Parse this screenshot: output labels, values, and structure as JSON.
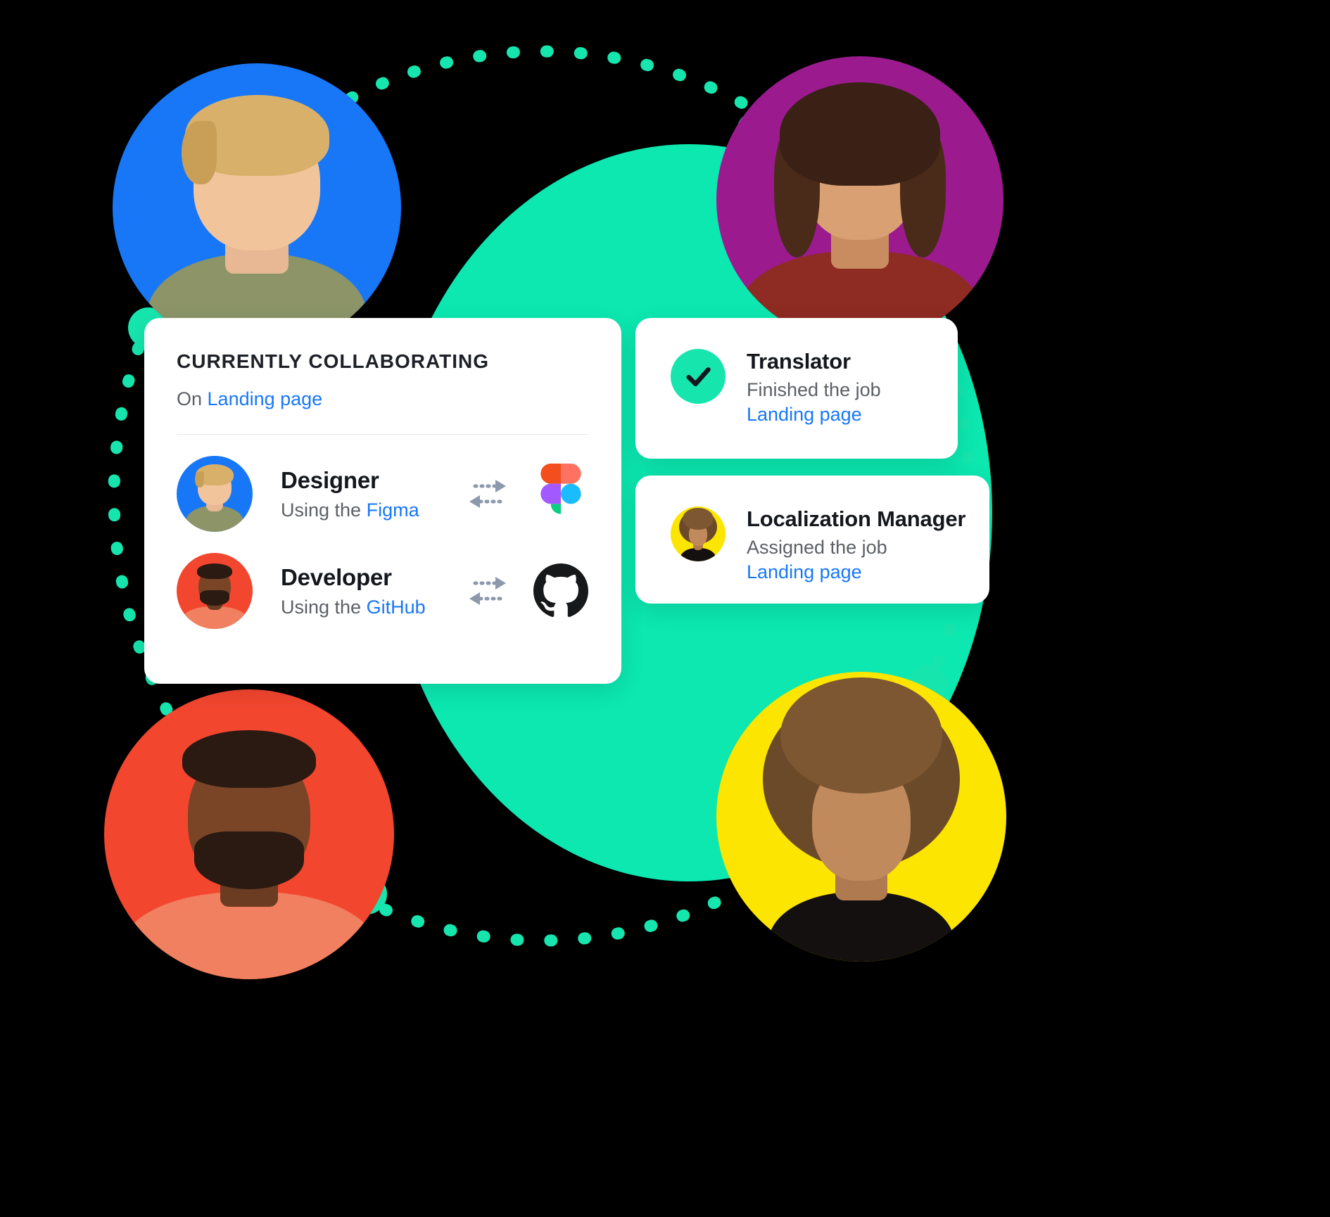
{
  "colors": {
    "accent_green": "#16E6AE",
    "blob_green": "#0CE8B0",
    "link_blue": "#1877F7",
    "avatar_blue": "#1877F7",
    "avatar_magenta": "#9B1B8F",
    "avatar_red": "#F2462F",
    "avatar_yellow": "#FCE500",
    "card_white": "#FFFFFF",
    "text_dark": "#14181D",
    "text_muted": "#5C6066",
    "background": "#000000"
  },
  "main_card": {
    "title": "CURRENTLY COLLABORATING",
    "subtitle_prefix": "On ",
    "subtitle_link": "Landing page",
    "rows": [
      {
        "name": "Designer",
        "desc_prefix": "Using the ",
        "desc_link": "Figma",
        "avatar_color": "#1877F7",
        "sync_icon": "sync-arrows-icon",
        "brand_icon": "figma-icon"
      },
      {
        "name": "Developer",
        "desc_prefix": "Using the ",
        "desc_link": "GitHub",
        "avatar_color": "#F2462F",
        "sync_icon": "sync-arrows-icon",
        "brand_icon": "github-icon"
      }
    ]
  },
  "translator_card": {
    "icon": "check-circle-icon",
    "title": "Translator",
    "status": "Finished the job",
    "link": "Landing page"
  },
  "localization_card": {
    "icon": "avatar-localization-manager",
    "title": "Localization Manager",
    "status": "Assigned the job",
    "link": "Landing page"
  },
  "decoration": {
    "ring_label": "dotted-connection-ring",
    "nodes": [
      "node-top-left",
      "node-top-right",
      "node-bottom-right",
      "node-bottom-left"
    ],
    "avatars": [
      {
        "name": "avatar-designer",
        "position": "top-left",
        "bg": "#1877F7"
      },
      {
        "name": "avatar-translator",
        "position": "top-right",
        "bg": "#9B1B8F"
      },
      {
        "name": "avatar-developer",
        "position": "bottom-left",
        "bg": "#F2462F"
      },
      {
        "name": "avatar-manager",
        "position": "bottom-right",
        "bg": "#FCE500"
      }
    ]
  }
}
